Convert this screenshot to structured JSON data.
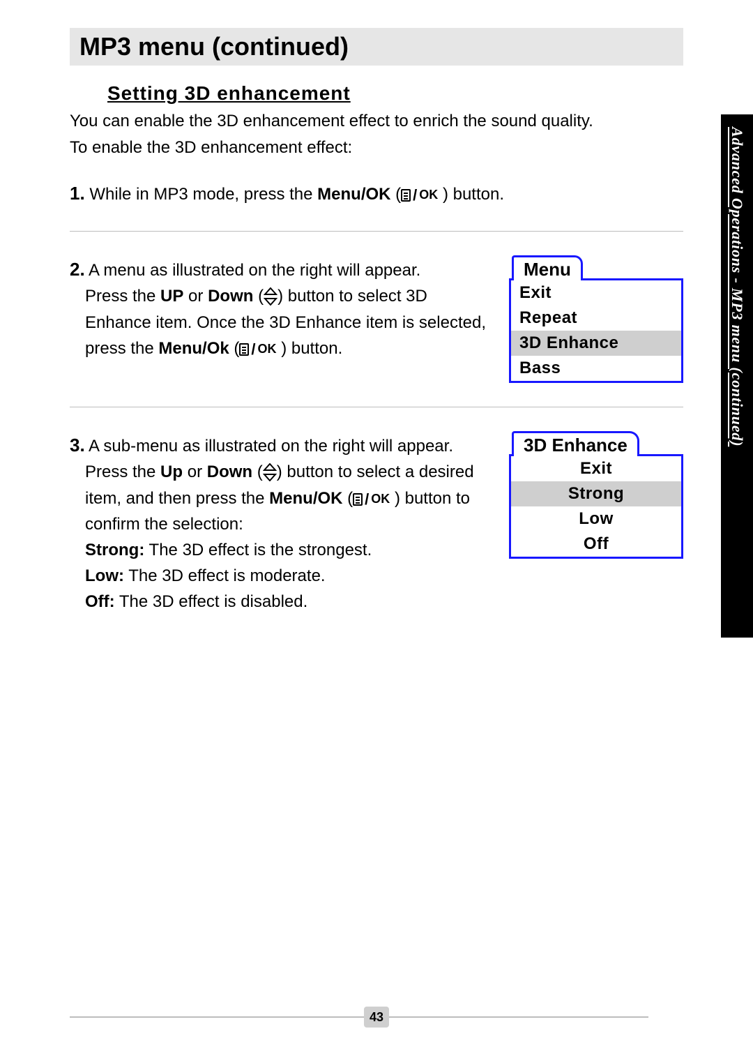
{
  "header": "MP3 menu (continued)",
  "section_title": "Setting 3D enhancement",
  "intro_line1": "You can enable the 3D enhancement effect to enrich the sound quality.",
  "intro_line2": "To enable the 3D enhancement effect:",
  "steps": {
    "s1": {
      "num": "1.",
      "t1": " While in MP3 mode, press the ",
      "b1": "Menu/OK",
      "t2": " (",
      "t3": " ) button."
    },
    "s2": {
      "num": "2.",
      "t1": " A menu as illustrated on the right will appear.",
      "t2": "Press the ",
      "b1": "UP",
      "t3": " or ",
      "b2": "Down",
      "t4": " (",
      "t5": ") button to select 3D Enhance item. Once the 3D Enhance item is selected, press the ",
      "b3": "Menu/Ok",
      "t6": " (",
      "t7": " ) button."
    },
    "s3": {
      "num": "3.",
      "t1": " A sub-menu as illustrated on the right will appear.",
      "t2": "Press the ",
      "b1": "Up",
      "t3": " or ",
      "b2": "Down",
      "t4": " (",
      "t5": ") button to select a desired item, and then press the ",
      "b3": "Menu/OK",
      "t6": " (",
      "t7": " ) button to confirm the selection:",
      "opt1_b": "Strong:",
      "opt1_t": " The 3D effect is the strongest.",
      "opt2_b": "Low:",
      "opt2_t": " The 3D effect is moderate.",
      "opt3_b": "Off:",
      "opt3_t": " The 3D effect is disabled."
    }
  },
  "menu1": {
    "tab": "Menu",
    "items": [
      "Exit",
      "Repeat",
      "3D Enhance",
      "Bass"
    ],
    "selected_index": 2
  },
  "menu2": {
    "tab": "3D Enhance",
    "items": [
      "Exit",
      "Strong",
      "Low",
      "Off"
    ],
    "selected_index": 1
  },
  "sidebar": "Advanced Operations - MP3 menu (continued)",
  "page_number": "43"
}
